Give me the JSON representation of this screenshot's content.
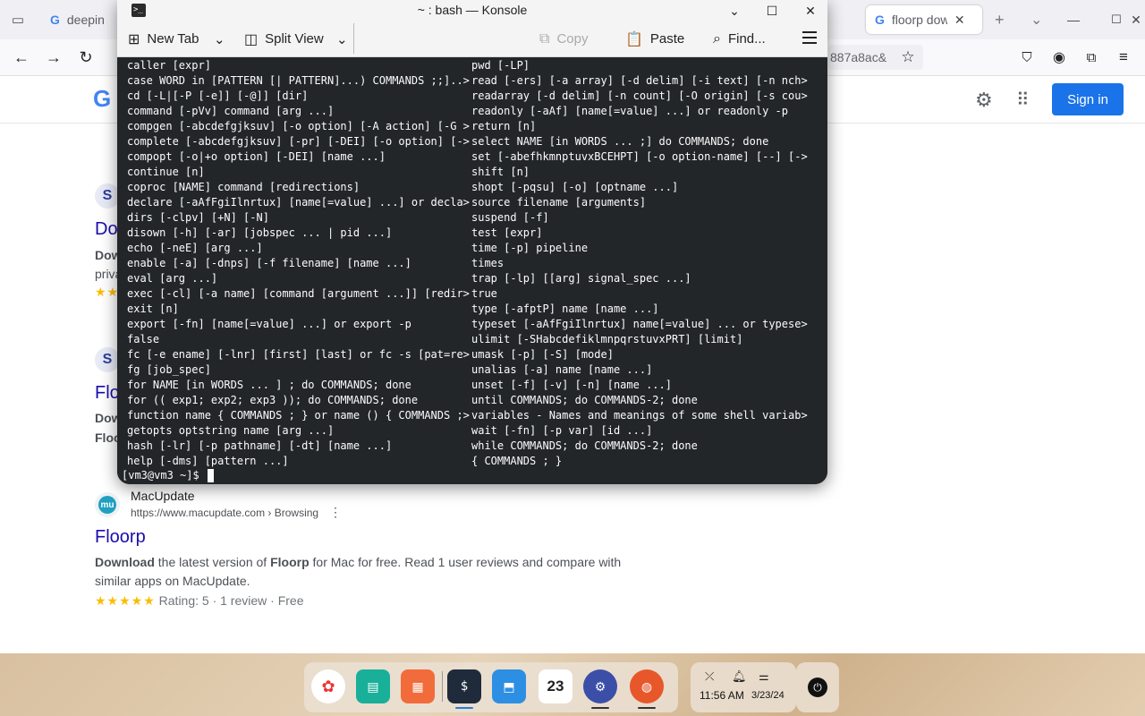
{
  "browser": {
    "tabs": [
      {
        "label": "deepin",
        "active": false
      },
      {
        "label": "floorp dow",
        "active": true
      }
    ],
    "new_tab_glyph": "+",
    "list_glyph": "⌄",
    "url_fragment": "887a8ac&",
    "google": {
      "signin_label": "Sign in",
      "partial_results": [
        {
          "icon_letter": "S",
          "title": "Do",
          "snippet_1": "Dow",
          "snippet_2": "priva",
          "stars": "★★"
        },
        {
          "icon_letter": "S",
          "title": "Flo",
          "snippet_1": "Dow",
          "snippet_2": "Floo"
        }
      ],
      "macupdate_result": {
        "site_name": "MacUpdate",
        "url": "https://www.macupdate.com › Browsing",
        "title": "Floorp",
        "snippet_bold_1": "Download",
        "snippet_text_1": " the latest version of ",
        "snippet_bold_2": "Floorp",
        "snippet_text_2": " for Mac for free. Read 1 user reviews and compare with similar apps on MacUpdate.",
        "stars": "★★★★★",
        "rating_text": "Rating: 5 · 1 review · Free"
      }
    }
  },
  "konsole": {
    "title": "~ : bash — Konsole",
    "toolbar": {
      "new_tab": "New Tab",
      "split_view": "Split View",
      "copy": "Copy",
      "paste": "Paste",
      "find": "Find..."
    },
    "left_lines": [
      "caller [expr]",
      "case WORD in [PATTERN [| PATTERN]...) COMMANDS ;;]..>",
      "cd [-L|[-P [-e]] [-@]] [dir]",
      "command [-pVv] command [arg ...]",
      "compgen [-abcdefgjksuv] [-o option] [-A action] [-G >",
      "complete [-abcdefgjksuv] [-pr] [-DEI] [-o option] [->",
      "compopt [-o|+o option] [-DEI] [name ...]",
      "continue [n]",
      "coproc [NAME] command [redirections]",
      "declare [-aAfFgiIlnrtux] [name[=value] ...] or decla>",
      "dirs [-clpv] [+N] [-N]",
      "disown [-h] [-ar] [jobspec ... | pid ...]",
      "echo [-neE] [arg ...]",
      "enable [-a] [-dnps] [-f filename] [name ...]",
      "eval [arg ...]",
      "exec [-cl] [-a name] [command [argument ...]] [redir>",
      "exit [n]",
      "export [-fn] [name[=value] ...] or export -p",
      "false",
      "fc [-e ename] [-lnr] [first] [last] or fc -s [pat=re>",
      "fg [job_spec]",
      "for NAME [in WORDS ... ] ; do COMMANDS; done",
      "for (( exp1; exp2; exp3 )); do COMMANDS; done",
      "function name { COMMANDS ; } or name () { COMMANDS ;>",
      "getopts optstring name [arg ...]",
      "hash [-lr] [-p pathname] [-dt] [name ...]",
      "help [-dms] [pattern ...]"
    ],
    "right_lines": [
      "pwd [-LP]",
      "read [-ers] [-a array] [-d delim] [-i text] [-n nch>",
      "readarray [-d delim] [-n count] [-O origin] [-s cou>",
      "readonly [-aAf] [name[=value] ...] or readonly -p",
      "return [n]",
      "select NAME [in WORDS ... ;] do COMMANDS; done",
      "set [-abefhkmnptuvxBCEHPT] [-o option-name] [--] [->",
      "shift [n]",
      "shopt [-pqsu] [-o] [optname ...]",
      "source filename [arguments]",
      "suspend [-f]",
      "test [expr]",
      "time [-p] pipeline",
      "times",
      "trap [-lp] [[arg] signal_spec ...]",
      "true",
      "type [-afptP] name [name ...]",
      "typeset [-aAfFgiIlnrtux] name[=value] ... or typese>",
      "ulimit [-SHabcdefiklmnpqrstuvxPRT] [limit]",
      "umask [-p] [-S] [mode]",
      "unalias [-a] name [name ...]",
      "unset [-f] [-v] [-n] [name ...]",
      "until COMMANDS; do COMMANDS-2; done",
      "variables - Names and meanings of some shell variab>",
      "wait [-fn] [-p var] [id ...]",
      "while COMMANDS; do COMMANDS-2; done",
      "{ COMMANDS ; }"
    ],
    "prompt": "[vm3@vm3 ~]$ "
  },
  "dock": {
    "calendar_day": "23",
    "terminal_glyph": "$",
    "tray": {
      "time": "11:56 AM",
      "date": "3/23/24"
    }
  },
  "colors": {
    "terminal_bg": "#232629",
    "terminal_fg": "#fcfcfc",
    "google_blue": "#1a73e8",
    "link": "#1a0dab",
    "star": "#fbbc04"
  }
}
